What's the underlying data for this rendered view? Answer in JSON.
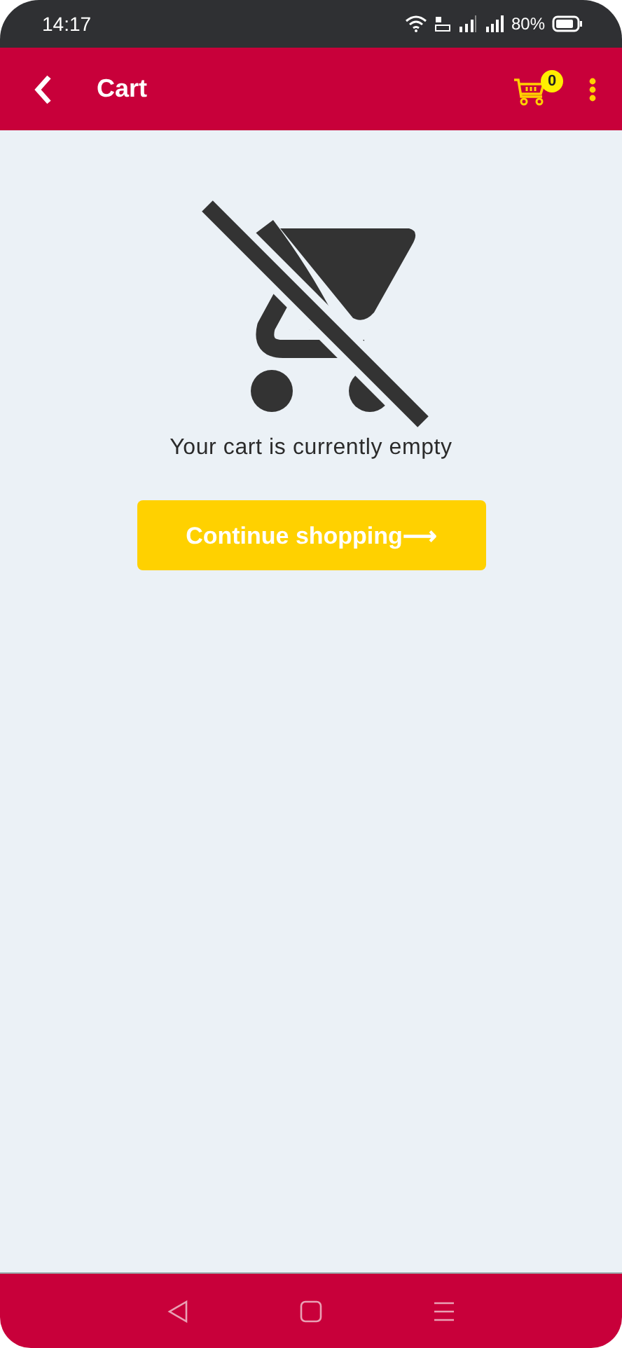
{
  "status_bar": {
    "time": "14:17",
    "battery": "80%"
  },
  "header": {
    "title": "Cart",
    "cart_count": "0"
  },
  "empty_state": {
    "message": "Your cart is currently empty",
    "button": "Continue shopping⟶"
  }
}
